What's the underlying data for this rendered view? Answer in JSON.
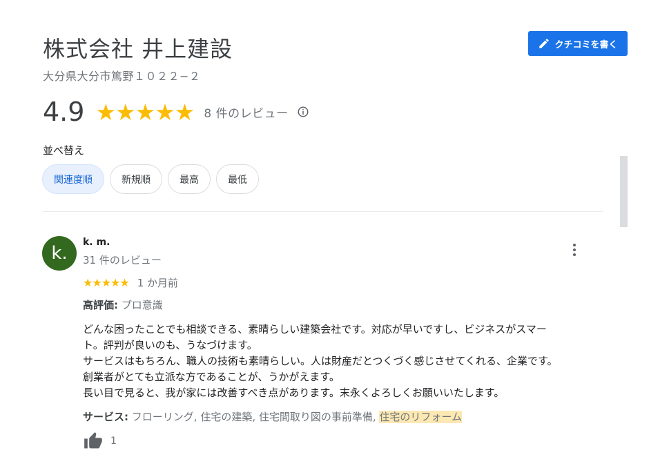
{
  "business": {
    "name": "株式会社 井上建設",
    "address": "大分県大分市篤野１０２２−２",
    "rating": "4.9",
    "stars": "★★★★★",
    "review_count": "8 件のレビュー"
  },
  "write_review_label": "クチコミを書く",
  "sort": {
    "label": "並べ替え",
    "options": [
      "関連度順",
      "新規順",
      "最高",
      "最低"
    ],
    "selected": "関連度順"
  },
  "review": {
    "avatar_letter": "k.",
    "author": "k. m.",
    "author_reviews": "31 件のレビュー",
    "stars": "★★★★★",
    "time": "1 か月前",
    "highlight_label": "高評価:",
    "highlight_value": "プロ意識",
    "body_lines": [
      "どんな困ったことでも相談できる、素晴らしい建築会社です。対応が早いですし、ビジネスがスマー",
      "ト。評判が良いのも、うなづけます。",
      "サービスはもちろん、職人の技術も素晴らしい。人は財産だとつくづく感じさせてくれる、企業です。",
      "創業者がとても立派な方であることが、うかがえます。",
      "長い目で見ると、我が家には改善すべき点があります。末永くよろしくお願いいたします。"
    ],
    "services_label": "サービス:",
    "services_value": "フローリング, 住宅の建築, 住宅間取り図の事前準備, ",
    "services_highlight": "住宅のリフォーム",
    "likes": "1"
  },
  "colors": {
    "accent": "#1a73e8",
    "star": "#fbbc04",
    "avatar": "#33691e",
    "chip_selected_bg": "#e8f0fe",
    "service_highlight": "#fce8b2"
  },
  "icons": {
    "write": "pencil-icon",
    "info": "info-icon",
    "more": "more-vert-icon",
    "like": "thumb-up-icon"
  }
}
